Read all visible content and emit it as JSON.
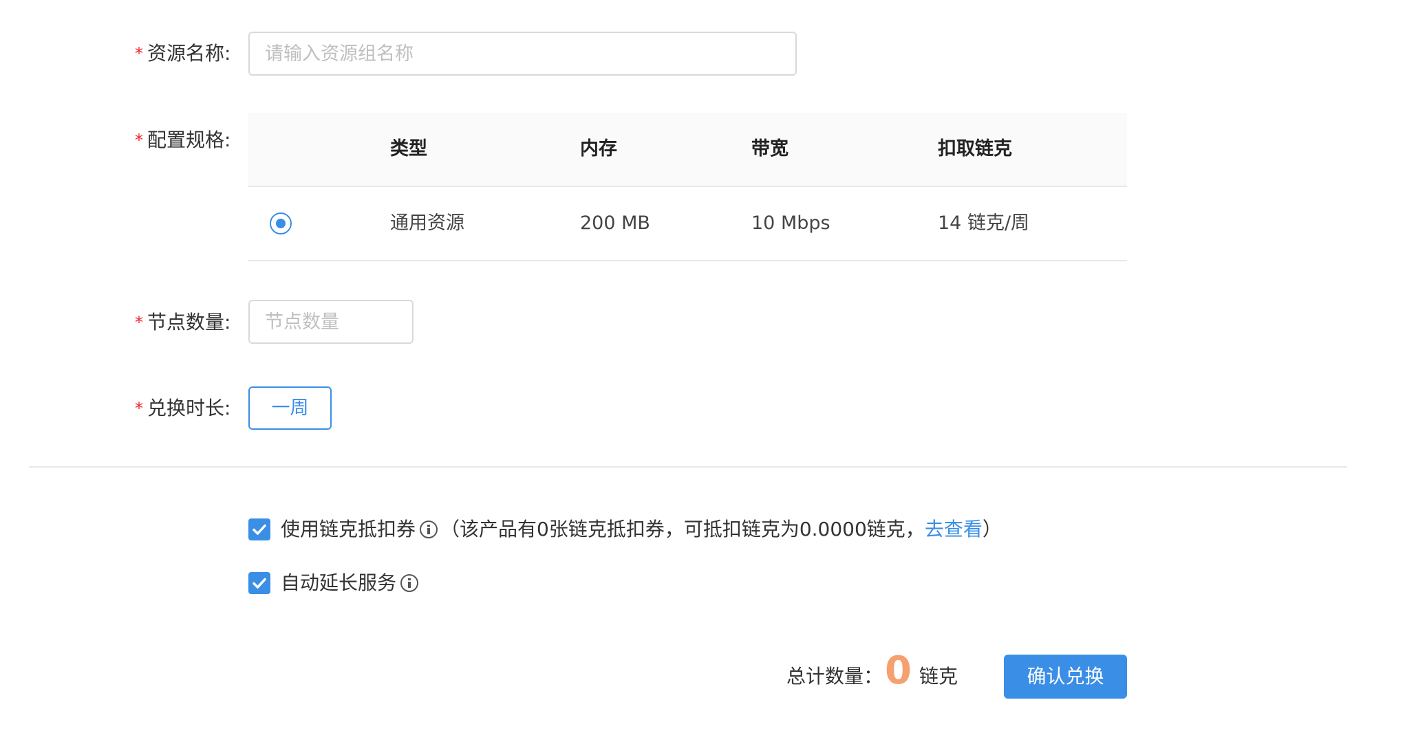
{
  "form": {
    "resource_name": {
      "label": "资源名称:",
      "placeholder": "请输入资源组名称",
      "value": ""
    },
    "spec": {
      "label": "配置规格:",
      "columns": [
        "类型",
        "内存",
        "带宽",
        "扣取链克"
      ],
      "rows": [
        {
          "selected": true,
          "type": "通用资源",
          "memory": "200 MB",
          "bandwidth": "10 Mbps",
          "cost": "14 链克/周"
        }
      ]
    },
    "node_count": {
      "label": "节点数量:",
      "placeholder": "节点数量",
      "value": ""
    },
    "duration": {
      "label": "兑换时长:",
      "option": "一周"
    },
    "required_mark": "*"
  },
  "options": {
    "coupon": {
      "checked": true,
      "label": "使用链克抵扣券",
      "note_before": "（该产品有0张链克抵扣券，可抵扣链克为0.0000链克，",
      "link": "去查看",
      "note_after": "）"
    },
    "auto_extend": {
      "checked": true,
      "label": "自动延长服务"
    }
  },
  "footer": {
    "total_label": "总计数量：",
    "total_value": "0",
    "unit": "链克",
    "confirm_label": "确认兑换"
  },
  "colors": {
    "accent": "#3a8ee6",
    "required": "#f5222d",
    "total_value": "#f5a06e"
  }
}
